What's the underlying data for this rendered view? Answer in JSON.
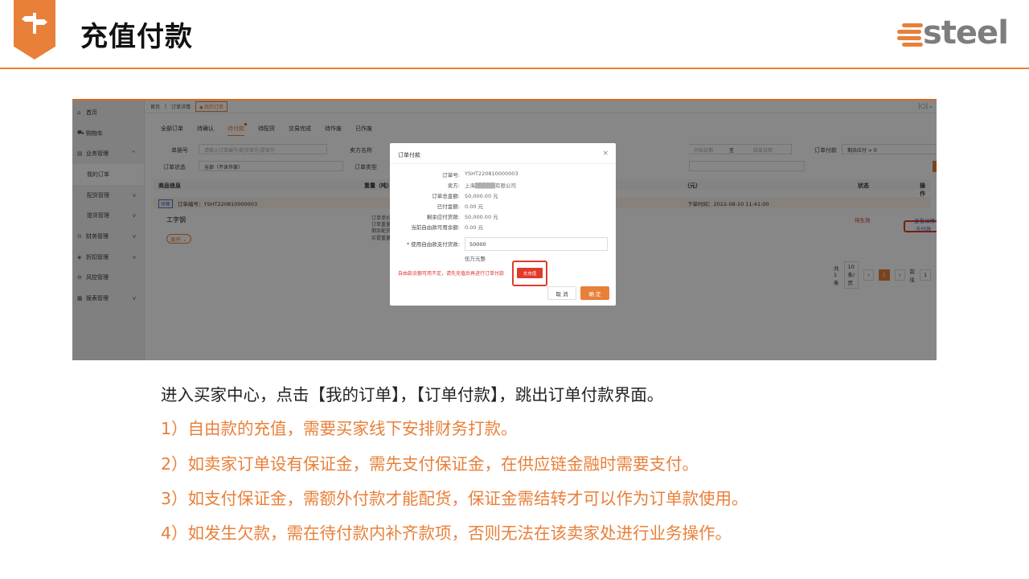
{
  "slide": {
    "title": "充值付款",
    "logo_text": "steel",
    "accent": "#e8803a",
    "intro": "进入买家中心，点击【我的订单】，【订单付款】，跳出订单付款界面。",
    "points": [
      "1）自由款的充值，需要买家线下安排财务打款。",
      "2）如卖家订单设有保证金，需先支付保证金，在供应链金融时需要支付。",
      "3）如支付保证金，需额外付款才能配货，保证金需结转才可以作为订单款使用。",
      "4）如发生欠款，需在待付款内补齐款项，否则无法在该卖家处进行业务操作。"
    ]
  },
  "app": {
    "sidebar": [
      {
        "label": "首页",
        "icon": "home-icon",
        "glyph": "⌂"
      },
      {
        "label": "购物车",
        "icon": "cart-icon",
        "glyph": "⛟"
      },
      {
        "label": "业务管理",
        "icon": "grid-icon",
        "glyph": "▤",
        "chev": "^"
      },
      {
        "label": "我的订单",
        "sub": true,
        "active": true
      },
      {
        "label": "配货管理",
        "sub": true,
        "chev": "v"
      },
      {
        "label": "提货管理",
        "sub": true,
        "chev": "v"
      },
      {
        "label": "财务管理",
        "icon": "finance-icon",
        "glyph": "⊙",
        "chev": "v"
      },
      {
        "label": "折扣管理",
        "icon": "discount-icon",
        "glyph": "◈",
        "chev": "v"
      },
      {
        "label": "风控管理",
        "icon": "risk-icon",
        "glyph": "⊖"
      },
      {
        "label": "报表管理",
        "icon": "report-icon",
        "glyph": "▦",
        "chev": "v"
      }
    ],
    "tabbar": {
      "home": "首页",
      "detail": "订单详情",
      "current": "我的订单"
    },
    "status_tabs": [
      "全部订单",
      "待确认",
      "待付款",
      "待配货",
      "交易完成",
      "待作废",
      "已作废"
    ],
    "filters": {
      "order_no_label": "单据号",
      "order_no_placeholder": "请输入订单编号/配货单号/提单号",
      "seller_label": "卖方名称",
      "status_label": "订单状态",
      "status_value": "全部（不含作废）",
      "type_label": "订单类型",
      "date_from": "开始日期",
      "date_sep": "至",
      "date_to": "结束日期",
      "pay_label": "订单付款",
      "pay_value": "剩余应付 > 0",
      "query": "查询",
      "reset": "重置"
    },
    "table": {
      "headers": [
        "商品信息",
        "重量（吨）",
        "（元）",
        "状态",
        "操作"
      ],
      "tag": "预售",
      "order_no": "订单编号：YSHT220810000003",
      "order_time": "下单时间：2022-08-10 11:41:00",
      "product": "工字钢",
      "expand": "展开 ⌄",
      "meta": [
        "订单单价：1,000.00元",
        "订单重量：50.000000吨",
        "剩余配货重量：0.000000吨",
        "实提重量：0.000000吨"
      ],
      "status": "待生效",
      "view_detail": "查看详情",
      "pay_link": "去付款"
    },
    "pager": {
      "total": "共 1 条",
      "page_size": "10条/页",
      "prev": "‹",
      "current": "1",
      "next": "›",
      "goto": "前往",
      "goto_value": "1",
      "goto_suffix": "页"
    }
  },
  "dialog": {
    "title": "订单付款",
    "close": "×",
    "rows": [
      {
        "k": "订单号:",
        "v": "YSHT220810000003"
      },
      {
        "k": "卖方:",
        "v": "上海▒▒▒▒▒有限公司"
      },
      {
        "k": "订单总金额:",
        "v": "50,000.00 元"
      },
      {
        "k": "已付金额:",
        "v": "0.00 元"
      },
      {
        "k": "剩余应付货款:",
        "v": "50,000.00 元"
      },
      {
        "k": "当前自由款可用余额:",
        "v": "0.00 元"
      }
    ],
    "input_label": "* 使用自由款支付货款:",
    "input_value": "50000",
    "amount_words": "伍万元整",
    "warning": "自由款余额可用不足，请先充值后再进行订单付款",
    "recharge": "去充值",
    "cancel": "取 消",
    "ok": "确 定"
  }
}
